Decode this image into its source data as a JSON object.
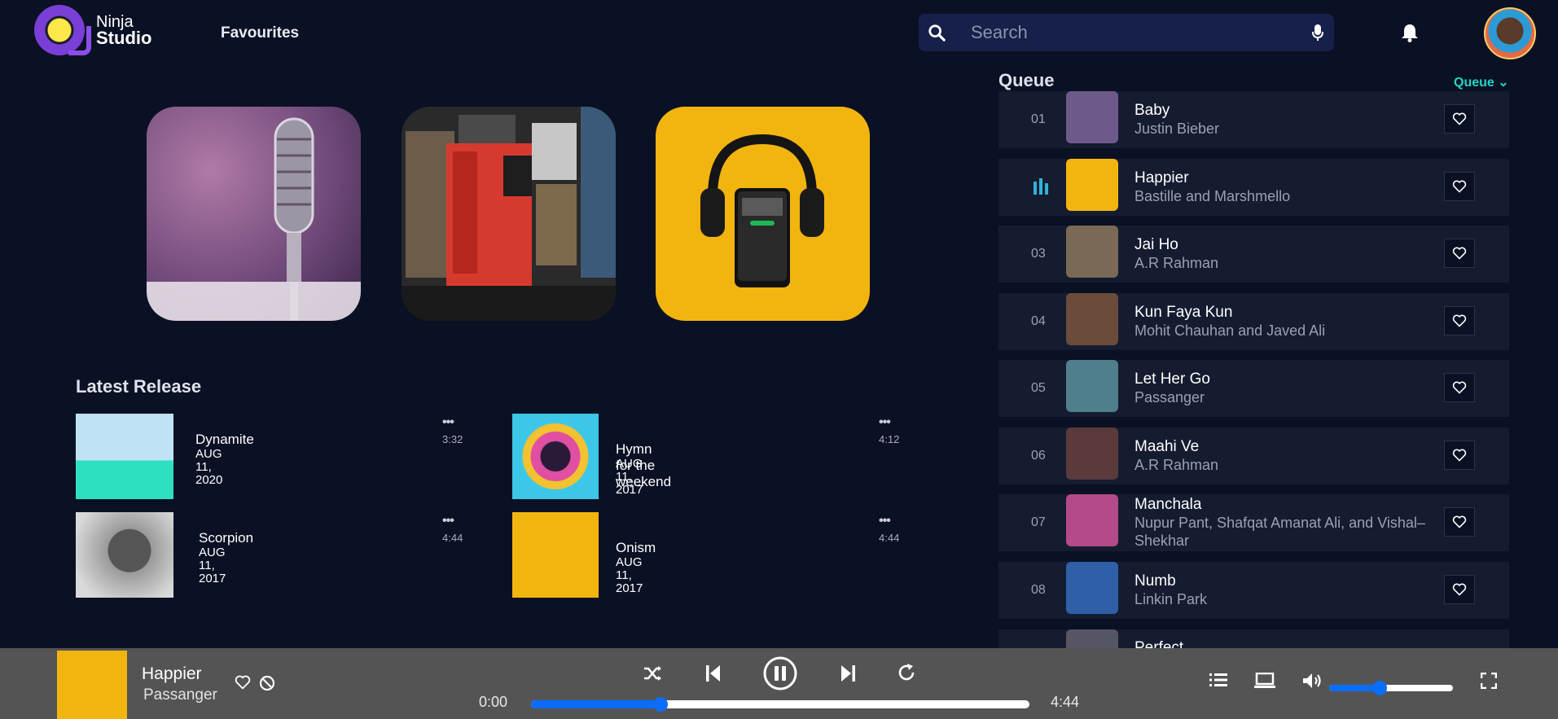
{
  "brand": {
    "line1": "Ninja",
    "line2": "Studio"
  },
  "nav": {
    "favourites": "Favourites"
  },
  "search": {
    "placeholder": "Search"
  },
  "latest": {
    "title": "Latest Release",
    "items": [
      {
        "title": "Dynamite",
        "date_line1": "AUG 11,",
        "date_line2": "2020",
        "duration": "3:32"
      },
      {
        "title": "Hymn for the weekend",
        "date": "AUG 11, 2017",
        "duration": "4:12"
      },
      {
        "title": "Scorpion",
        "date_line1": "AUG 11,",
        "date_line2": "2017",
        "duration": "4:44"
      },
      {
        "title": "Onism",
        "date": "AUG 11, 2017",
        "duration": "4:44"
      }
    ]
  },
  "queue": {
    "title": "Queue",
    "dropdown": "Queue",
    "items": [
      {
        "num": "01",
        "title": "Baby",
        "artist": "Justin Bieber",
        "color": "#6d5a8a"
      },
      {
        "num": "",
        "title": "Happier",
        "artist": "Bastille and Marshmello",
        "color": "#f2b40f",
        "playing": true
      },
      {
        "num": "03",
        "title": "Jai Ho",
        "artist": "A.R Rahman",
        "color": "#7a6a55"
      },
      {
        "num": "04",
        "title": "Kun Faya Kun",
        "artist": "Mohit Chauhan and Javed Ali",
        "color": "#6b4b3a"
      },
      {
        "num": "05",
        "title": "Let Her Go",
        "artist": "Passanger",
        "color": "#4f7f8c"
      },
      {
        "num": "06",
        "title": "Maahi Ve",
        "artist": "A.R Rahman",
        "color": "#5a3a3a"
      },
      {
        "num": "07",
        "title": "Manchala",
        "artist": "Nupur Pant, Shafqat Amanat Ali, and Vishal–Shekhar",
        "color": "#b44a8a"
      },
      {
        "num": "08",
        "title": "Numb",
        "artist": "Linkin Park",
        "color": "#2f5fa8"
      },
      {
        "num": "",
        "title": "Perfect",
        "artist": "",
        "color": "#555566"
      }
    ]
  },
  "player": {
    "title": "Happier",
    "artist": "Passanger",
    "current_time": "0:00",
    "total_time": "4:44",
    "progress": 0.26,
    "volume": 0.41
  },
  "colors": {
    "accent": "#0b6dfb",
    "teal": "#21d6c4",
    "bg": "#0b1124",
    "row": "#151c30"
  }
}
